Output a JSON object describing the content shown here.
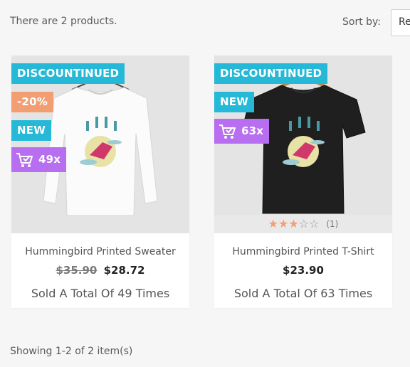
{
  "header": {
    "product_count": "There are 2 products.",
    "sort_label": "Sort by:",
    "sort_value": "Relevance"
  },
  "products": [
    {
      "badges": {
        "discontinued": "DISCOUNTINUED",
        "discount": "-20%",
        "new": "NEW",
        "sold": "49x"
      },
      "name": "Hummingbird Printed Sweater",
      "old_price": "$35.90",
      "price": "$28.72",
      "sold_text": "Sold A Total Of 49 Times",
      "shirt_color": "#ffffff"
    },
    {
      "badges": {
        "discontinued": "DISCOUNTINUED",
        "new": "NEW",
        "sold": "63x"
      },
      "rating": 3,
      "rating_max": 5,
      "rating_count": "(1)",
      "name": "Hummingbird Printed T-Shirt",
      "price": "$23.90",
      "sold_text": "Sold A Total Of 63 Times",
      "shirt_color": "#1f1f1f"
    }
  ],
  "footer": {
    "showing": "Showing 1-2 of 2 item(s)"
  },
  "colors": {
    "badge_blue": "#25b9d7",
    "badge_orange": "#f39d72",
    "badge_purple": "#b86ef0",
    "star_on": "#f39d72"
  }
}
